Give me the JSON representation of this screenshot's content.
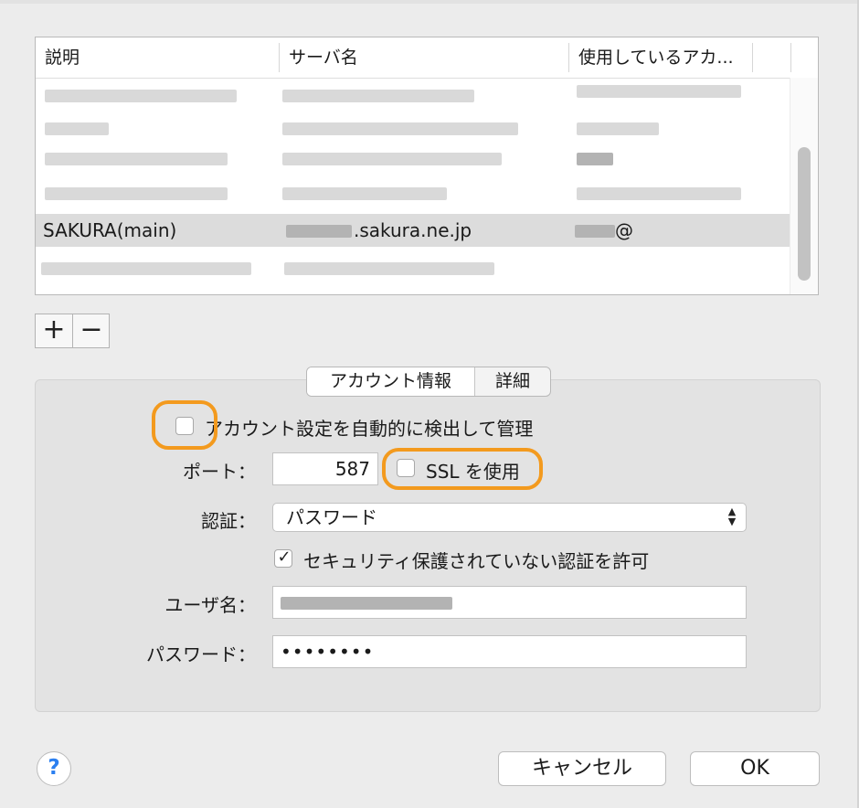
{
  "table": {
    "columns": [
      "説明",
      "サーバ名",
      "使用しているアカ..."
    ],
    "selected_row": {
      "description": "SAKURA(main)",
      "server": ".sakura.ne.jp",
      "account": "@"
    }
  },
  "buttons": {
    "add": "+",
    "remove": "−"
  },
  "tabs": {
    "account_info": "アカウント情報",
    "details": "詳細"
  },
  "auto_manage_label": "アカウント設定を自動的に検出して管理",
  "port": {
    "label": "ポート：",
    "value": "587"
  },
  "ssl_label": "SSL を使用",
  "auth": {
    "label": "認証：",
    "value": "パスワード"
  },
  "allow_insecure_label": "セキュリティ保護されていない認証を許可",
  "username_label": "ユーザ名：",
  "password": {
    "label": "パスワード：",
    "value": "••••••••"
  },
  "dialog": {
    "help": "?",
    "cancel": "キャンセル",
    "ok": "OK"
  },
  "colors": {
    "highlight": "#f39a1e",
    "selected_row": "#dcdcdc",
    "group_bg": "#e3e3e3"
  },
  "icons": {
    "help": "help-icon",
    "popup": "up-down-chevron-icon",
    "check": "checkmark-icon"
  }
}
